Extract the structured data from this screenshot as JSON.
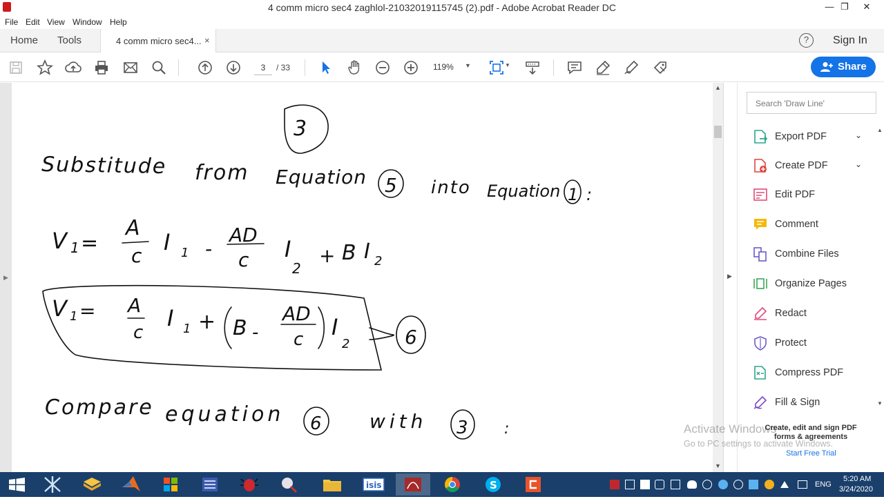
{
  "window": {
    "title": "4 comm micro sec4 zaghlol-21032019115745 (2).pdf - Adobe Acrobat Reader DC",
    "minimize": "—",
    "restore": "❐",
    "close": "✕"
  },
  "menubar": {
    "items": [
      "File",
      "Edit",
      "View",
      "Window",
      "Help"
    ]
  },
  "tabs": {
    "home": "Home",
    "tools": "Tools",
    "document": "4 comm micro sec4...",
    "close": "×",
    "help": "?",
    "sign_in": "Sign In"
  },
  "toolbar": {
    "current_page": "3",
    "total_pages": "/ 33",
    "zoom": "119%",
    "share_label": "Share",
    "icons": [
      "save-icon",
      "bookmark-star-icon",
      "upload-icon",
      "print-icon",
      "email-icon",
      "search-icon",
      "page-up-icon",
      "page-down-icon",
      "select-arrow-icon",
      "hand-icon",
      "zoom-out-icon",
      "zoom-in-icon",
      "fit-page-icon",
      "scroll-mode-icon",
      "comment-icon",
      "highlight-pen-icon",
      "sign-icon",
      "fill-sign-icon"
    ]
  },
  "document": {
    "page_number_mark": "3",
    "lines": [
      "Substitude from equation (5) into equation (1) :",
      "V1 = A/C I1 - AD/C I2 + B I2",
      "V1 = A/C I1 + (B - AD/C) I2 → (6)",
      "Compare equation (6) with (3) :"
    ]
  },
  "right_pane": {
    "search_placeholder": "Search 'Draw Line'",
    "tools": [
      {
        "label": "Export PDF",
        "icon": "export-pdf-icon",
        "expand": "⌵"
      },
      {
        "label": "Create PDF",
        "icon": "create-pdf-icon",
        "expand": "⌵"
      },
      {
        "label": "Edit PDF",
        "icon": "edit-pdf-icon"
      },
      {
        "label": "Comment",
        "icon": "comment-icon"
      },
      {
        "label": "Combine Files",
        "icon": "combine-files-icon"
      },
      {
        "label": "Organize Pages",
        "icon": "organize-pages-icon"
      },
      {
        "label": "Redact",
        "icon": "redact-icon"
      },
      {
        "label": "Protect",
        "icon": "protect-icon"
      },
      {
        "label": "Compress PDF",
        "icon": "compress-pdf-icon"
      },
      {
        "label": "Fill & Sign",
        "icon": "fill-sign-icon"
      }
    ],
    "promo": "Create, edit and sign PDF forms & agreements",
    "trial": "Start Free Trial"
  },
  "watermark": {
    "line1": "Activate Windows",
    "line2": "Go to PC settings to activate Windows."
  },
  "taskbar": {
    "lang": "ENG",
    "time": "5:20 AM",
    "date": "3/24/2020",
    "apps": [
      "start-button",
      "app-1",
      "file-explorer-1",
      "matlab",
      "office",
      "app-5",
      "bug-app",
      "app-7",
      "file-explorer",
      "isis",
      "acrobat",
      "chrome",
      "skype",
      "app-13"
    ]
  },
  "colors": {
    "accent": "#1473e6",
    "taskbar": "#1a3f6b"
  }
}
